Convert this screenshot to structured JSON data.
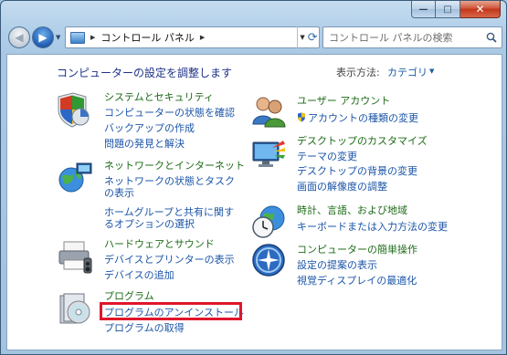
{
  "window": {
    "minimize_glyph": "—",
    "maximize_glyph": "□",
    "close_glyph": "✕"
  },
  "navbar": {
    "back_glyph": "◀",
    "forward_glyph": "▶",
    "address_label": "コントロール パネル",
    "refresh_glyph": "⟳",
    "search_placeholder": "コントロール パネルの検索"
  },
  "content": {
    "heading": "コンピューターの設定を調整します",
    "view_by_label": "表示方法:",
    "view_by_value": "カテゴリ",
    "categories": [
      {
        "title": "システムとセキュリティ",
        "links": [
          "コンピューターの状態を確認",
          "バックアップの作成",
          "問題の発見と解決"
        ]
      },
      {
        "title": "ネットワークとインターネット",
        "links": [
          "ネットワークの状態とタスクの表示",
          "ホームグループと共有に関するオプションの選択"
        ]
      },
      {
        "title": "ハードウェアとサウンド",
        "links": [
          "デバイスとプリンターの表示",
          "デバイスの追加"
        ]
      },
      {
        "title": "プログラム",
        "links": [
          "プログラムのアンインストール",
          "プログラムの取得"
        ]
      },
      {
        "title": "ユーザー アカウント",
        "links": [
          "アカウントの種類の変更"
        ]
      },
      {
        "title": "デスクトップのカスタマイズ",
        "links": [
          "テーマの変更",
          "デスクトップの背景の変更",
          "画面の解像度の調整"
        ]
      },
      {
        "title": "時計、言語、および地域",
        "links": [
          "キーボードまたは入力方法の変更"
        ]
      },
      {
        "title": "コンピューターの簡単操作",
        "links": [
          "設定の提案の表示",
          "視覚ディスプレイの最適化"
        ]
      }
    ]
  },
  "colors": {
    "category_title": "#1d6b18",
    "link": "#1b55a8",
    "heading": "#1e3287",
    "highlight_box": "#e0162b"
  }
}
